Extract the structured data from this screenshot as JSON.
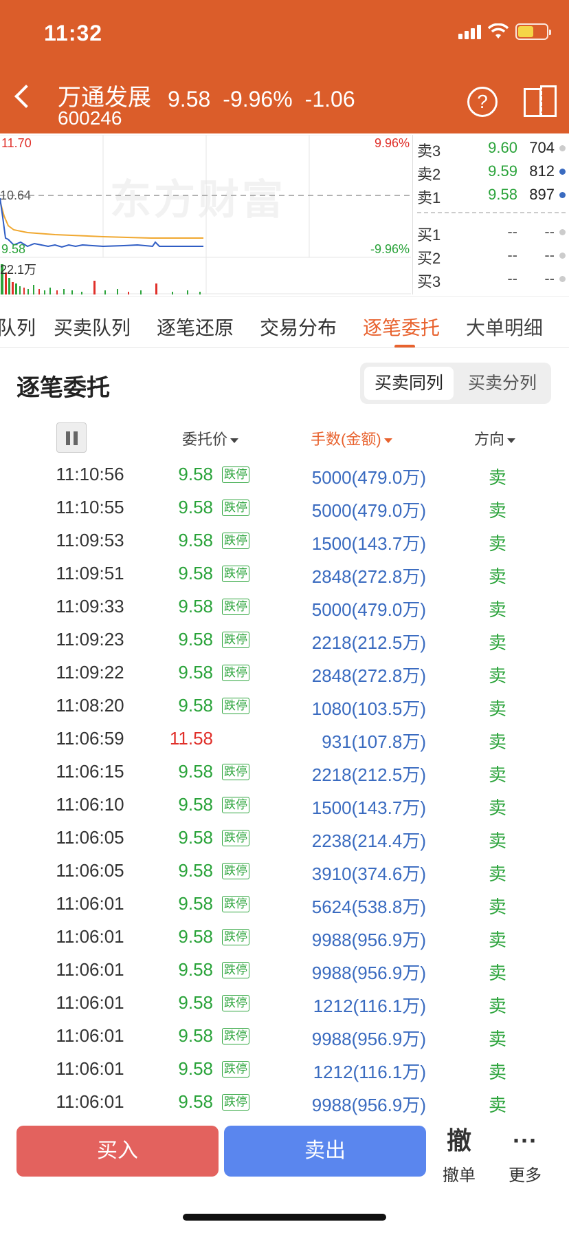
{
  "status_bar": {
    "time": "11:32"
  },
  "header": {
    "stock_name": "万通发展",
    "stock_code": "600246",
    "price": "9.58",
    "change_pct": "-9.96%",
    "change": "-1.06",
    "help_icon": "help-circle-icon",
    "screen_icon": "split-screen-icon"
  },
  "chart": {
    "high_price": "11.70",
    "high_pct": "9.96%",
    "prev_close": "10.64",
    "low_price": "9.58",
    "low_pct": "-9.96%",
    "volume_label": "22.1万",
    "watermark": "东方财富"
  },
  "depth": {
    "asks": [
      {
        "label": "卖3",
        "price": "9.60",
        "vol": "704"
      },
      {
        "label": "卖2",
        "price": "9.59",
        "vol": "812"
      },
      {
        "label": "卖1",
        "price": "9.58",
        "vol": "897"
      }
    ],
    "bids": [
      {
        "label": "买1",
        "price": "--",
        "vol": "--"
      },
      {
        "label": "买2",
        "price": "--",
        "vol": "--"
      },
      {
        "label": "买3",
        "price": "--",
        "vol": "--"
      }
    ]
  },
  "tabs": [
    "队列",
    "买卖队列",
    "逐笔还原",
    "交易分布",
    "逐笔委托",
    "大单明细"
  ],
  "active_tab": "逐笔委托",
  "section": {
    "title": "逐笔委托",
    "seg_left": "买卖同列",
    "seg_right": "买卖分列"
  },
  "columns": {
    "price": "委托价",
    "volume": "手数(金额)",
    "direction": "方向"
  },
  "orders": [
    {
      "time": "11:10:56",
      "price": "9.58",
      "tag": "跌停",
      "vol": "5000(479.0万)",
      "dir": "卖"
    },
    {
      "time": "11:10:55",
      "price": "9.58",
      "tag": "跌停",
      "vol": "5000(479.0万)",
      "dir": "卖"
    },
    {
      "time": "11:09:53",
      "price": "9.58",
      "tag": "跌停",
      "vol": "1500(143.7万)",
      "dir": "卖"
    },
    {
      "time": "11:09:51",
      "price": "9.58",
      "tag": "跌停",
      "vol": "2848(272.8万)",
      "dir": "卖"
    },
    {
      "time": "11:09:33",
      "price": "9.58",
      "tag": "跌停",
      "vol": "5000(479.0万)",
      "dir": "卖"
    },
    {
      "time": "11:09:23",
      "price": "9.58",
      "tag": "跌停",
      "vol": "2218(212.5万)",
      "dir": "卖"
    },
    {
      "time": "11:09:22",
      "price": "9.58",
      "tag": "跌停",
      "vol": "2848(272.8万)",
      "dir": "卖"
    },
    {
      "time": "11:08:20",
      "price": "9.58",
      "tag": "跌停",
      "vol": "1080(103.5万)",
      "dir": "卖"
    },
    {
      "time": "11:06:59",
      "price": "11.58",
      "tag": "",
      "vol": "931(107.8万)",
      "dir": "卖"
    },
    {
      "time": "11:06:15",
      "price": "9.58",
      "tag": "跌停",
      "vol": "2218(212.5万)",
      "dir": "卖"
    },
    {
      "time": "11:06:10",
      "price": "9.58",
      "tag": "跌停",
      "vol": "1500(143.7万)",
      "dir": "卖"
    },
    {
      "time": "11:06:05",
      "price": "9.58",
      "tag": "跌停",
      "vol": "2238(214.4万)",
      "dir": "卖"
    },
    {
      "time": "11:06:05",
      "price": "9.58",
      "tag": "跌停",
      "vol": "3910(374.6万)",
      "dir": "卖"
    },
    {
      "time": "11:06:01",
      "price": "9.58",
      "tag": "跌停",
      "vol": "5624(538.8万)",
      "dir": "卖"
    },
    {
      "time": "11:06:01",
      "price": "9.58",
      "tag": "跌停",
      "vol": "9988(956.9万)",
      "dir": "卖"
    },
    {
      "time": "11:06:01",
      "price": "9.58",
      "tag": "跌停",
      "vol": "9988(956.9万)",
      "dir": "卖"
    },
    {
      "time": "11:06:01",
      "price": "9.58",
      "tag": "跌停",
      "vol": "1212(116.1万)",
      "dir": "卖"
    },
    {
      "time": "11:06:01",
      "price": "9.58",
      "tag": "跌停",
      "vol": "9988(956.9万)",
      "dir": "卖"
    },
    {
      "time": "11:06:01",
      "price": "9.58",
      "tag": "跌停",
      "vol": "1212(116.1万)",
      "dir": "卖"
    },
    {
      "time": "11:06:01",
      "price": "9.58",
      "tag": "跌停",
      "vol": "9988(956.9万)",
      "dir": "卖"
    }
  ],
  "actions": {
    "buy": "买入",
    "sell": "卖出",
    "cancel_icon": "撤",
    "cancel": "撤单",
    "more_icon": "···",
    "more": "更多"
  },
  "colors": {
    "brand": "#DB5D2A",
    "up": "#E0302A",
    "down": "#2AA33A",
    "blue": "#3A6BC0"
  }
}
